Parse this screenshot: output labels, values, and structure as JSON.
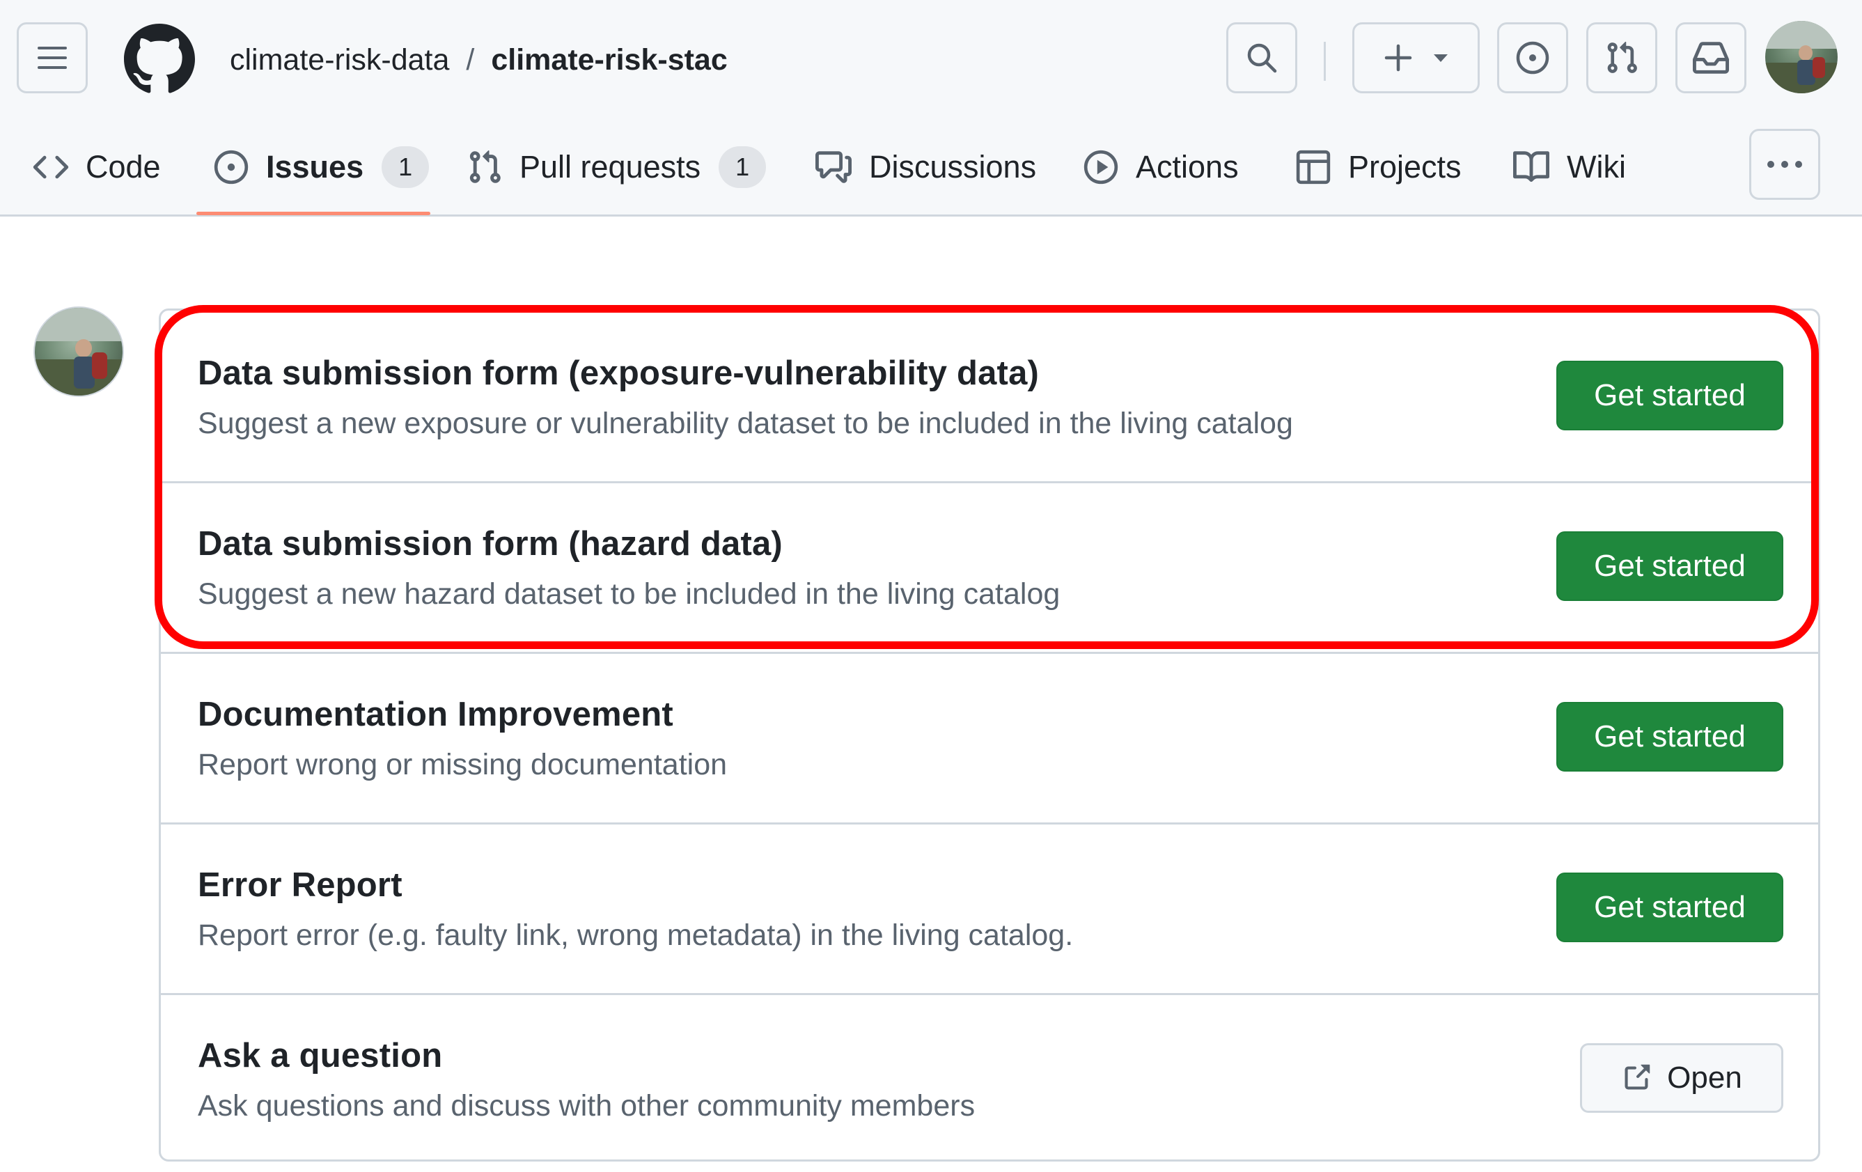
{
  "header": {
    "owner": "climate-risk-data",
    "separator": "/",
    "repo": "climate-risk-stac",
    "icons": [
      "menu-icon",
      "github-logo-icon",
      "search-icon",
      "plus-icon",
      "triangle-down-icon",
      "issue-opened-icon",
      "git-pull-request-icon",
      "inbox-icon"
    ]
  },
  "tabs": [
    {
      "label": "Code",
      "icon": "code-icon"
    },
    {
      "label": "Issues",
      "icon": "issue-opened-icon",
      "counter": "1",
      "active": true
    },
    {
      "label": "Pull requests",
      "icon": "git-pull-request-icon",
      "counter": "1"
    },
    {
      "label": "Discussions",
      "icon": "comment-discussion-icon"
    },
    {
      "label": "Actions",
      "icon": "play-icon"
    },
    {
      "label": "Projects",
      "icon": "table-icon"
    },
    {
      "label": "Wiki",
      "icon": "book-icon"
    }
  ],
  "templates": [
    {
      "title": "Data submission form (exposure-vulnerability data)",
      "description": "Suggest a new exposure or vulnerability dataset to be included in the living catalog",
      "button": "Get started"
    },
    {
      "title": "Data submission form (hazard data)",
      "description": "Suggest a new hazard dataset to be included in the living catalog",
      "button": "Get started"
    },
    {
      "title": "Documentation Improvement",
      "description": "Report wrong or missing documentation",
      "button": "Get started"
    },
    {
      "title": "Error Report",
      "description": "Report error (e.g. faulty link, wrong metadata) in the living catalog.",
      "button": "Get started"
    },
    {
      "title": "Ask a question",
      "description": "Ask questions and discuss with other community members",
      "button": "Open",
      "button_icon": "link-external-icon"
    }
  ],
  "colors": {
    "primary_button": "#1f883d",
    "highlight_annotation": "#ff0000",
    "active_tab_underline": "#fd8c73"
  }
}
